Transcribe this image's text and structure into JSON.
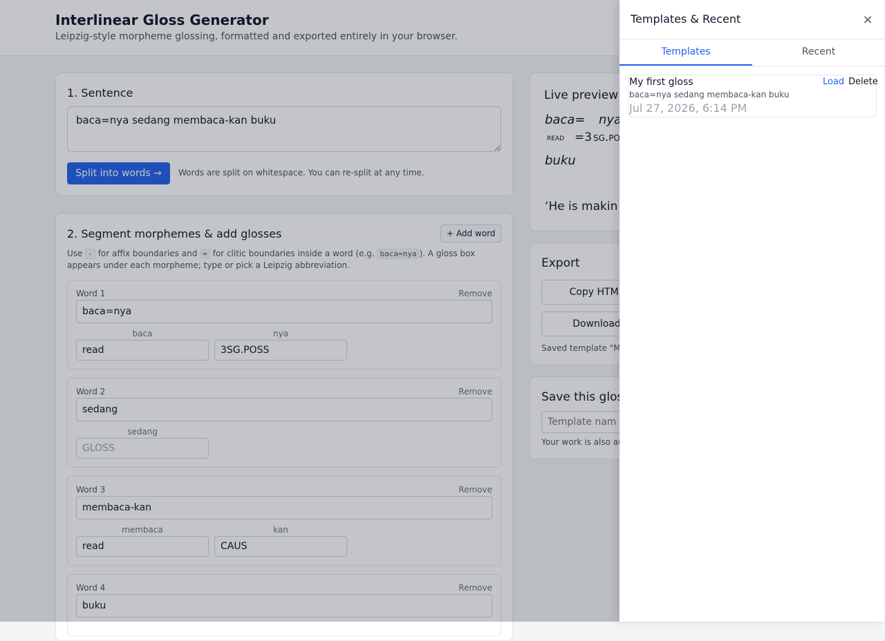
{
  "header": {
    "title": "Interlinear Gloss Generator",
    "subtitle": "Leipzig-style morpheme glossing, formatted and exported entirely in your browser."
  },
  "sentence": {
    "heading": "1. Sentence",
    "value": "baca=nya sedang membaca-kan buku",
    "split_label": "Split into words →",
    "hint": "Words are split on whitespace. You can re-split at any time."
  },
  "segment": {
    "heading": "2. Segment morphemes & add glosses",
    "add_word_label": "+ Add word",
    "desc_1": "Use",
    "code_affix": "-",
    "desc_2": "for affix boundaries and",
    "code_clitic": "=",
    "desc_3": "for clitic boundaries inside a word (e.g.",
    "code_example": "baca=nya",
    "desc_4": "). A gloss box appears under each morpheme; type or pick a Leipzig abbreviation.",
    "remove_label": "Remove",
    "gloss_placeholder": "GLOSS",
    "words": [
      {
        "label": "Word 1",
        "value": "baca=nya",
        "morphemes": [
          {
            "form": "baca",
            "gloss": "read"
          },
          {
            "form": "nya",
            "gloss": "3SG.POSS"
          }
        ]
      },
      {
        "label": "Word 2",
        "value": "sedang",
        "morphemes": [
          {
            "form": "sedang",
            "gloss": ""
          }
        ]
      },
      {
        "label": "Word 3",
        "value": "membaca-kan",
        "morphemes": [
          {
            "form": "membaca",
            "gloss": "read"
          },
          {
            "form": "kan",
            "gloss": "CAUS"
          }
        ]
      },
      {
        "label": "Word 4",
        "value": "buku"
      }
    ]
  },
  "preview": {
    "heading": "Live preview",
    "line1_word1": "baca=",
    "line1_word2": "nya",
    "line2_gloss1": "read",
    "line2_eq": "=3",
    "line2_gloss2": "sg.po",
    "line3_word": "buku",
    "translation": "‘He is makin"
  },
  "export": {
    "heading": "Export",
    "copy_html_label": "Copy HTML",
    "download_label": "Download",
    "status": "Saved template \"M"
  },
  "save": {
    "heading": "Save this glos",
    "name_placeholder": "Template nam",
    "note": "Your work is also au"
  },
  "drawer": {
    "title": "Templates & Recent",
    "close_icon": "×",
    "tabs": [
      {
        "label": "Templates",
        "active": true
      },
      {
        "label": "Recent",
        "active": false
      }
    ],
    "items": [
      {
        "name": "My first gloss",
        "text": "baca=nya sedang membaca-kan buku",
        "date": "Jul 27, 2026, 6:14 PM",
        "load_label": "Load",
        "delete_label": "Delete"
      }
    ]
  },
  "colors": {
    "accent": "#2563eb",
    "overlay": "rgba(17,24,39,0.25)"
  }
}
